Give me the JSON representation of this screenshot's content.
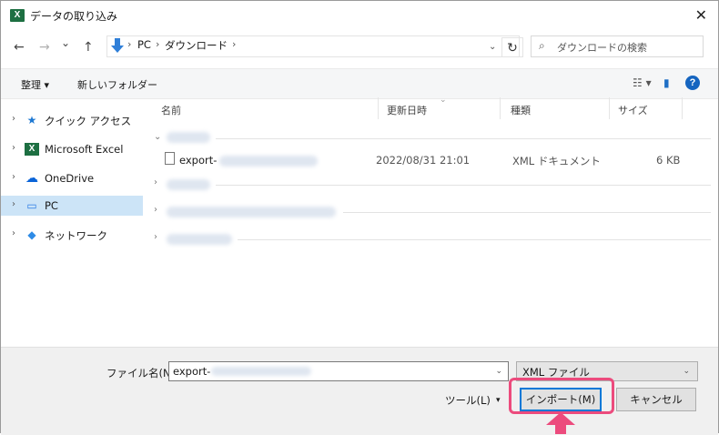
{
  "window": {
    "title": "データの取り込み",
    "close_glyph": "✕",
    "app_icon_letter": "X"
  },
  "address": {
    "back_glyph": "←",
    "forward_glyph": "→",
    "recent_glyph": "⌄",
    "up_glyph": "↑",
    "crumbs": [
      "PC",
      "ダウンロード"
    ],
    "sep_glyph": "›",
    "dropdown_glyph": "⌄",
    "refresh_glyph": "↻"
  },
  "search": {
    "placeholder": "ダウンロードの検索",
    "icon_glyph": "⌕"
  },
  "toolbar": {
    "organize": "整理 ▾",
    "new_folder": "新しいフォルダー",
    "view_glyph": "☷ ▾",
    "pane_glyph": "▮",
    "help_glyph": "?"
  },
  "nav": {
    "items": [
      {
        "label": "クイック アクセス",
        "icon": "star-icon",
        "glyph": "★",
        "color": "#1e78d2"
      },
      {
        "label": "Microsoft Excel",
        "icon": "excel-icon",
        "glyph": "X",
        "color": "#1d6f42"
      },
      {
        "label": "OneDrive",
        "icon": "cloud-icon",
        "glyph": "☁",
        "color": "#0a64d8"
      },
      {
        "label": "PC",
        "icon": "pc-icon",
        "glyph": "▭",
        "color": "#2c7be5",
        "selected": true
      },
      {
        "label": "ネットワーク",
        "icon": "network-icon",
        "glyph": "◆",
        "color": "#2e8be6"
      }
    ],
    "chevron": "›"
  },
  "columns": {
    "name": "名前",
    "modified": "更新日時",
    "type": "種類",
    "size": "サイズ"
  },
  "file": {
    "name": "export-",
    "modified": "2022/08/31 21:01",
    "type": "XML ドキュメント",
    "size": "6 KB"
  },
  "bottom": {
    "filename_label": "ファイル名(N):",
    "filename_value": "export-",
    "filetype": "XML ファイル",
    "tools": "ツール(L)",
    "tools_glyph": "▾",
    "import": "インポート(M)",
    "cancel": "キャンセル",
    "combo_glyph": "⌄"
  },
  "colors": {
    "highlight": "#ec4b7d",
    "selection": "#cce4f7",
    "accent": "#0078d7"
  }
}
